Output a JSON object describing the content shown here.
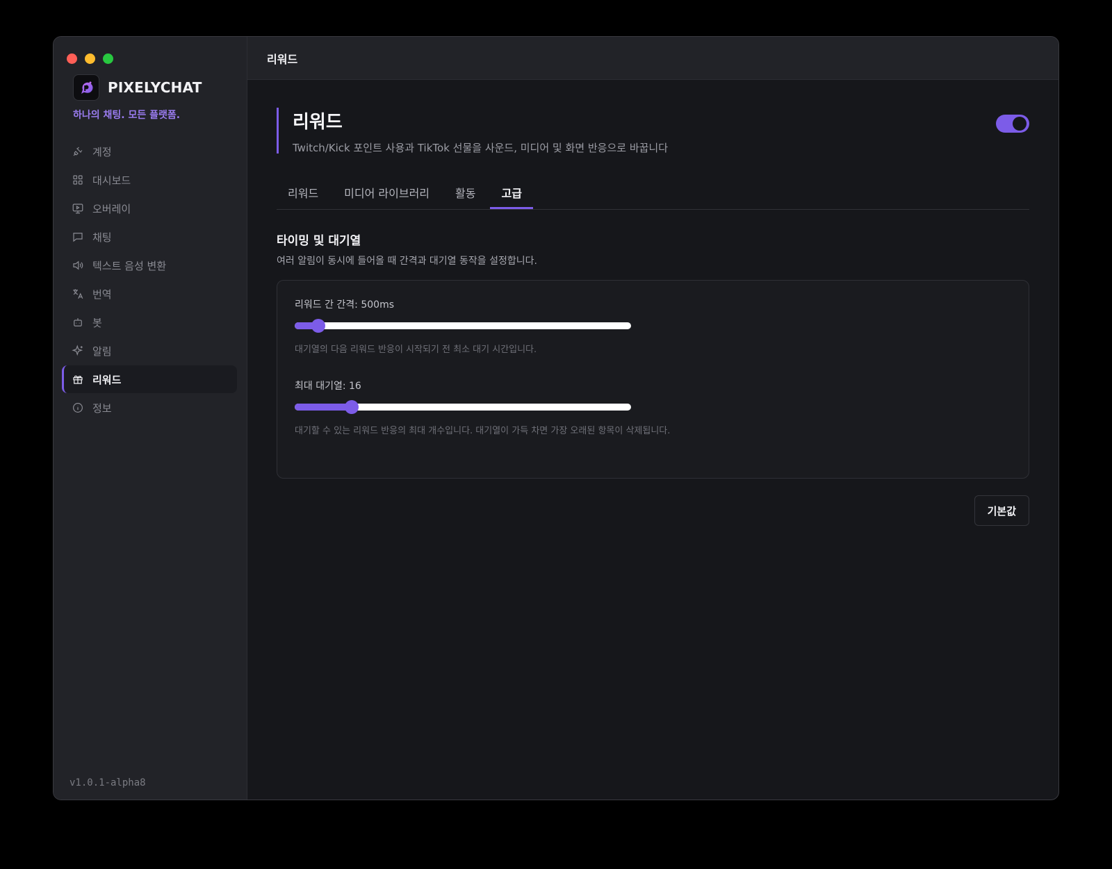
{
  "app": {
    "name": "PIXELYCHAT",
    "tagline": "하나의 채팅. 모든 플랫폼.",
    "version": "v1.0.1-alpha8"
  },
  "sidebar": {
    "items": [
      {
        "label": "계정",
        "icon": "plug-icon",
        "active": false
      },
      {
        "label": "대시보드",
        "icon": "dashboard-grid-icon",
        "active": false
      },
      {
        "label": "오버레이",
        "icon": "monitor-play-icon",
        "active": false
      },
      {
        "label": "채팅",
        "icon": "chat-bubble-icon",
        "active": false
      },
      {
        "label": "텍스트 음성 변환",
        "icon": "speaker-icon",
        "active": false
      },
      {
        "label": "번역",
        "icon": "translate-icon",
        "active": false
      },
      {
        "label": "봇",
        "icon": "bot-icon",
        "active": false
      },
      {
        "label": "알림",
        "icon": "sparkle-icon",
        "active": false
      },
      {
        "label": "리워드",
        "icon": "gift-icon",
        "active": true
      },
      {
        "label": "정보",
        "icon": "info-icon",
        "active": false
      }
    ]
  },
  "topbar": {
    "title": "리워드"
  },
  "page": {
    "title": "리워드",
    "description": "Twitch/Kick 포인트 사용과 TikTok 선물을 사운드, 미디어 및 화면 반응으로 바꿉니다",
    "enabled": true
  },
  "tabs": [
    {
      "label": "리워드",
      "active": false
    },
    {
      "label": "미디어 라이브러리",
      "active": false
    },
    {
      "label": "활동",
      "active": false
    },
    {
      "label": "고급",
      "active": true
    }
  ],
  "section": {
    "title": "타이밍 및 대기열",
    "description": "여러 알림이 동시에 들어올 때 간격과 대기열 동작을 설정합니다."
  },
  "fields": [
    {
      "label": "리워드 간 간격: 500ms",
      "help": "대기열의 다음 리워드 반응이 시작되기 전 최소 대기 시간입니다.",
      "fraction": 0.07
    },
    {
      "label": "최대 대기열: 16",
      "help": "대기할 수 있는 리워드 반응의 최대 개수입니다. 대기열이 가득 차면 가장 오래된 항목이 삭제됩니다.",
      "fraction": 0.17
    }
  ],
  "actions": {
    "reset_label": "기본값"
  },
  "colors": {
    "accent": "#7c5ce8",
    "tagline": "#9a7cf0"
  }
}
